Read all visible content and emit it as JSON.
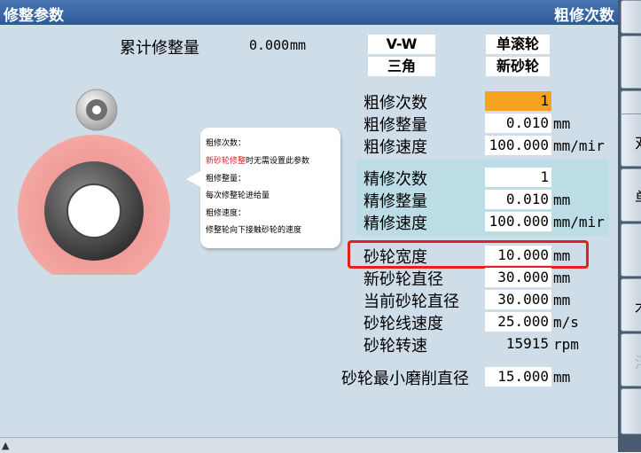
{
  "header": {
    "title": "修整参数",
    "mode": "粗修次数"
  },
  "cumulative": {
    "label": "累计修整量",
    "value": "0.000",
    "unit": "mm"
  },
  "selectors": {
    "profile": "V-W",
    "wheel_type": "单滚轮",
    "shape": "三角",
    "wheel_state": "新砂轮"
  },
  "rough": {
    "count_label": "粗修次数",
    "count": "1",
    "amount_label": "粗修整量",
    "amount": "0.010",
    "amount_unit": "mm",
    "speed_label": "粗修速度",
    "speed": "100.000",
    "speed_unit": "mm/mir"
  },
  "fine": {
    "count_label": "精修次数",
    "count": "1",
    "amount_label": "精修整量",
    "amount": "0.010",
    "amount_unit": "mm",
    "speed_label": "精修速度",
    "speed": "100.000",
    "speed_unit": "mm/mir"
  },
  "wheel": {
    "width_label": "砂轮宽度",
    "width": "10.000",
    "width_unit": "mm",
    "new_dia_label": "新砂轮直径",
    "new_dia": "30.000",
    "new_dia_unit": "mm",
    "cur_dia_label": "当前砂轮直径",
    "cur_dia": "30.000",
    "cur_dia_unit": "mm",
    "line_speed_label": "砂轮线速度",
    "line_speed": "25.000",
    "line_speed_unit": "m/s",
    "rpm_label": "砂轮转速",
    "rpm": "15915",
    "rpm_unit": "rpm",
    "min_dia_label": "砂轮最小磨削直径",
    "min_dia": "15.000",
    "min_dia_unit": "mm"
  },
  "help": {
    "l1": "粗修次数：",
    "l2_red": "新砂轮修整",
    "l2_rest": "时无需设置此参数",
    "l3": "粗修整量：",
    "l4": "每次修整轮进给量",
    "l5": "粗修速度：",
    "l6": "修整轮向下接触砂轮的速度"
  },
  "softkeys": [
    "",
    "",
    "",
    "对",
    "单",
    "",
    "木",
    "浮",
    ""
  ],
  "colors": {
    "title_bar": "#2f5a9a",
    "panel": "#cfdde8",
    "highlight": "#f7a21e",
    "fine_panel": "#bcdde6",
    "frame": "#e32020"
  }
}
